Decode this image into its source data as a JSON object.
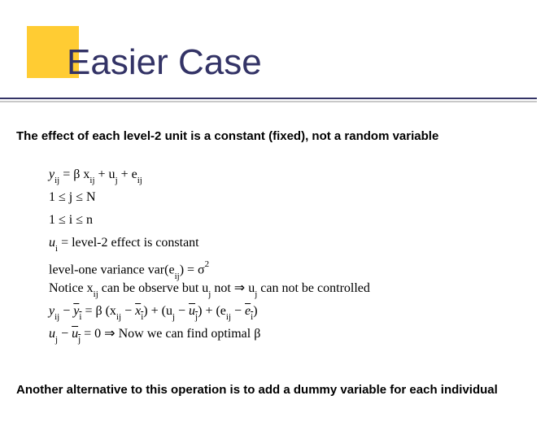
{
  "title": "Easier Case",
  "intro": "The effect of each level-2 unit is a constant  (fixed), not a random variable",
  "math": {
    "eq1_lhs": "y",
    "eq1_sub1": "ij",
    "eq1_mid1": " = β x",
    "eq1_sub2": "ij",
    "eq1_mid2": " + u",
    "eq1_sub3": "j",
    "eq1_mid3": " + e",
    "eq1_sub4": "ij",
    "range1": "1 ≤  j  ≤ N",
    "range2": "1 ≤  i  ≤ n",
    "eq2_a": "u",
    "eq2_sub": "i",
    "eq2_b": " =  level-2 effect is constant",
    "eq3_a": "level-one variance   var(e",
    "eq3_sub": "ij",
    "eq3_b": ") = σ",
    "eq3_sup": "2",
    "eq4_a": "Notice  x",
    "eq4_sub1": "ij",
    "eq4_b": " can be observe but u",
    "eq4_sub2": "j",
    "eq4_c": " not  ⇒  u",
    "eq4_sub3": "j",
    "eq4_d": " can not be controlled",
    "eq5_y": "y",
    "eq5_s1": "ij",
    "eq5_m1": " − ",
    "eq5_yb": "y",
    "eq5_s2": "i",
    "eq5_m2": " = β (x",
    "eq5_s3": "ij",
    "eq5_m3": " − ",
    "eq5_xb": "x",
    "eq5_s4": "i",
    "eq5_m4": ") + (u",
    "eq5_s5": "j",
    "eq5_m5": " − ",
    "eq5_ub": "u",
    "eq5_s6": "j",
    "eq5_m6": ") + (e",
    "eq5_s7": "ij",
    "eq5_m7": " − ",
    "eq5_eb": "e",
    "eq5_s8": "i",
    "eq5_m8": ")",
    "eq6_a": "u",
    "eq6_s1": "j",
    "eq6_m1": " − ",
    "eq6_ub": "u",
    "eq6_s2": "j",
    "eq6_m2": " = 0 ⇒  Now we can find optimal  β",
    "outro": "Another alternative to this operation is to add a dummy variable for each individual"
  }
}
